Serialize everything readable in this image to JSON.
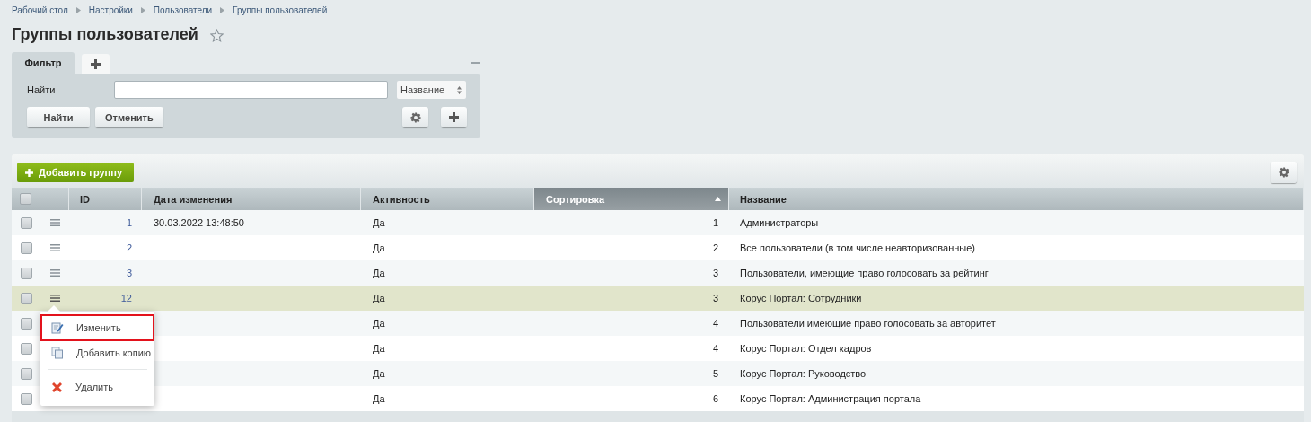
{
  "breadcrumbs": [
    "Рабочий стол",
    "Настройки",
    "Пользователи",
    "Группы пользователей"
  ],
  "title": "Группы пользователей",
  "favorite": false,
  "filter": {
    "tabs": [
      {
        "label": "Фильтр",
        "selected": true
      }
    ],
    "find_label": "Найти",
    "field_select": "Название",
    "buttons": [
      "Найти",
      "Отменить"
    ]
  },
  "add_button": "Добавить группу",
  "table": {
    "all_checked": false,
    "columns": [
      {
        "label": "ID",
        "sorted": false
      },
      {
        "label": "Дата изменения",
        "sorted": false
      },
      {
        "label": "Активность",
        "sorted": false
      },
      {
        "label": "Сортировка",
        "sorted": true
      },
      {
        "label": "Название",
        "sorted": false
      }
    ],
    "rows": [
      {
        "checked": false,
        "selected": false,
        "id": "1",
        "date": "30.03.2022 13:48:50",
        "active": "Да",
        "sort": "1",
        "name": "Администраторы"
      },
      {
        "checked": false,
        "selected": false,
        "id": "2",
        "active": "Да",
        "sort": "2",
        "name": "Все пользователи (в том числе неавторизованные)"
      },
      {
        "checked": false,
        "selected": false,
        "id": "3",
        "active": "Да",
        "sort": "3",
        "name": "Пользователи, имеющие право голосовать за рейтинг"
      },
      {
        "checked": false,
        "selected": true,
        "id": "12",
        "active": "Да",
        "sort": "3",
        "name": "Корус Портал: Сотрудники"
      },
      {
        "checked": false,
        "selected": false,
        "active": "Да",
        "sort": "4",
        "name": "Пользователи имеющие право голосовать за авторитет"
      },
      {
        "checked": false,
        "selected": false,
        "active": "Да",
        "sort": "4",
        "name": "Корус Портал: Отдел кадров"
      },
      {
        "checked": false,
        "selected": false,
        "active": "Да",
        "sort": "5",
        "name": "Корус Портал: Руководство"
      },
      {
        "checked": false,
        "selected": false,
        "active": "Да",
        "sort": "6",
        "name": "Корус Портал: Администрация портала"
      }
    ]
  },
  "context_menu": {
    "items": [
      {
        "kind": "edit",
        "label": "Изменить",
        "highlighted": true
      },
      {
        "kind": "copy",
        "label": "Добавить копию",
        "highlighted": false
      },
      {
        "kind": "separator"
      },
      {
        "kind": "delete",
        "label": "Удалить",
        "highlighted": false
      }
    ]
  }
}
